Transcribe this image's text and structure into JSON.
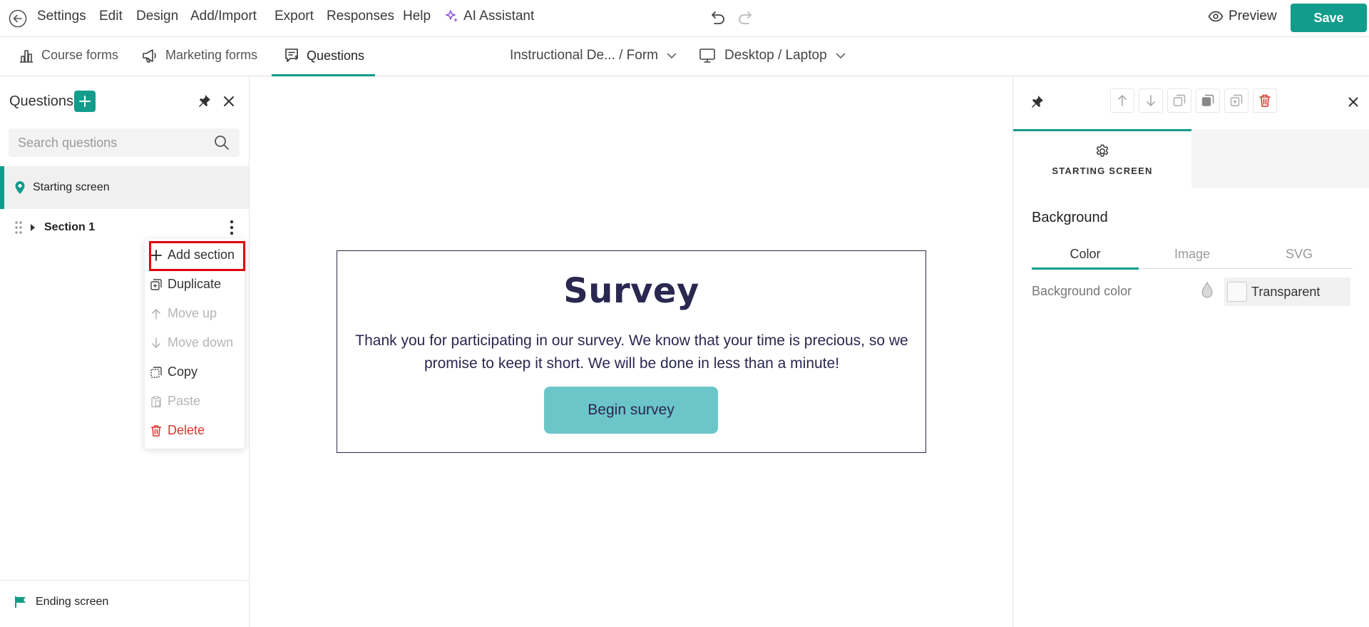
{
  "menu": {
    "items": [
      "Settings",
      "Edit",
      "Design",
      "Add/Import",
      "Export",
      "Responses",
      "Help"
    ],
    "ai_assistant": "AI Assistant",
    "preview": "Preview",
    "save": "Save"
  },
  "tabs": {
    "course_forms": "Course forms",
    "marketing_forms": "Marketing forms",
    "questions": "Questions",
    "form_selector": "Instructional De...  / Form",
    "device_selector": "Desktop / Laptop"
  },
  "left_panel": {
    "title": "Questions",
    "search_placeholder": "Search questions",
    "starting_screen": "Starting screen",
    "section_1": "Section 1",
    "ending_screen": "Ending screen"
  },
  "context_menu": {
    "add_section": "Add section",
    "duplicate": "Duplicate",
    "move_up": "Move up",
    "move_down": "Move down",
    "copy": "Copy",
    "paste": "Paste",
    "delete": "Delete"
  },
  "survey": {
    "title": "Survey",
    "text": "Thank you for participating in our survey. We know that your time is precious, so we promise to keep it short. We will be done in less than a minute!",
    "button": "Begin survey"
  },
  "right_panel": {
    "tab_label": "STARTING SCREEN",
    "background_heading": "Background",
    "subtabs": [
      "Color",
      "Image",
      "SVG"
    ],
    "background_color_label": "Background color",
    "background_color_value": "Transparent"
  },
  "colors": {
    "accent": "#129c8b",
    "danger": "#d9342b",
    "survey_text": "#2a2750",
    "begin_button": "#6cc6c9",
    "ai_purple": "#8a4fd8",
    "highlight_box": "#e0000f"
  }
}
